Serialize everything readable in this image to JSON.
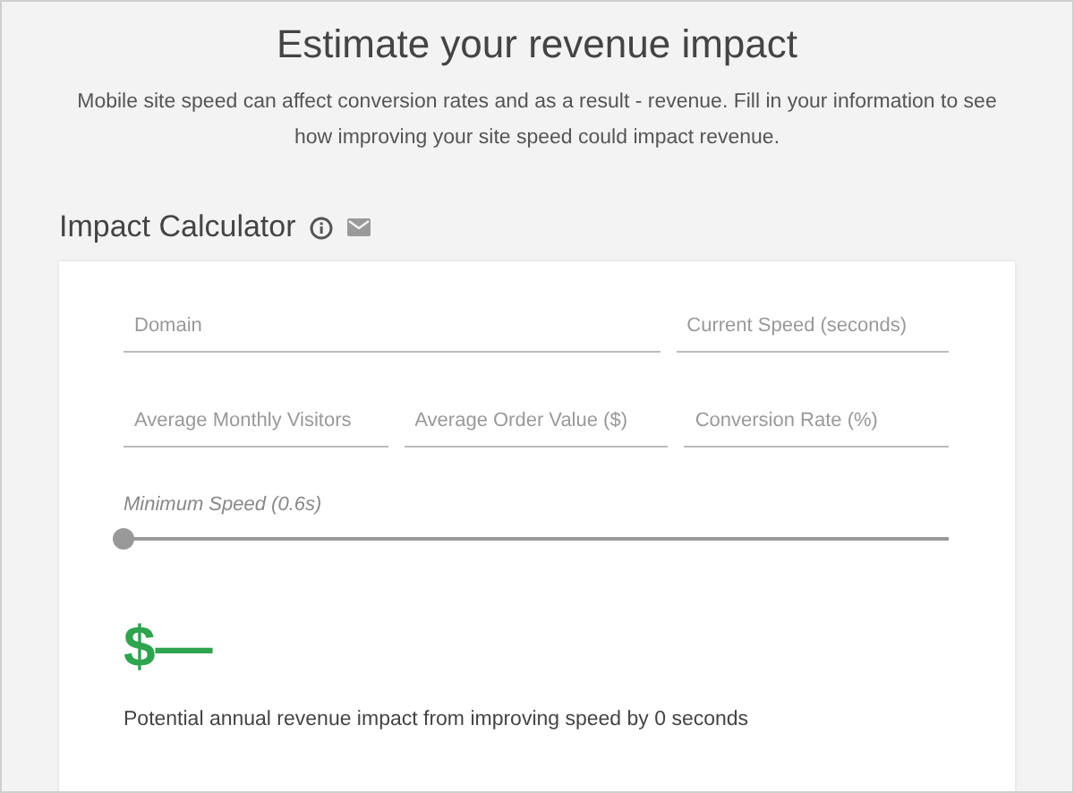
{
  "header": {
    "title": "Estimate your revenue impact",
    "description": "Mobile site speed can affect conversion rates and as a result - revenue. Fill in your information to see how improving your site speed could impact revenue."
  },
  "calculator": {
    "title": "Impact Calculator",
    "fields": [
      [
        {
          "placeholder": "Domain"
        },
        {
          "placeholder": "Current Speed (seconds)"
        }
      ],
      [
        {
          "placeholder": "Average Monthly Visitors"
        },
        {
          "placeholder": "Average Order Value ($)"
        },
        {
          "placeholder": "Conversion Rate (%)"
        }
      ]
    ],
    "slider": {
      "label": "Minimum Speed (0.6s)",
      "level": 0
    },
    "result": {
      "amount": "$—",
      "caption": "Potential annual revenue impact from improving speed by 0 seconds"
    }
  }
}
